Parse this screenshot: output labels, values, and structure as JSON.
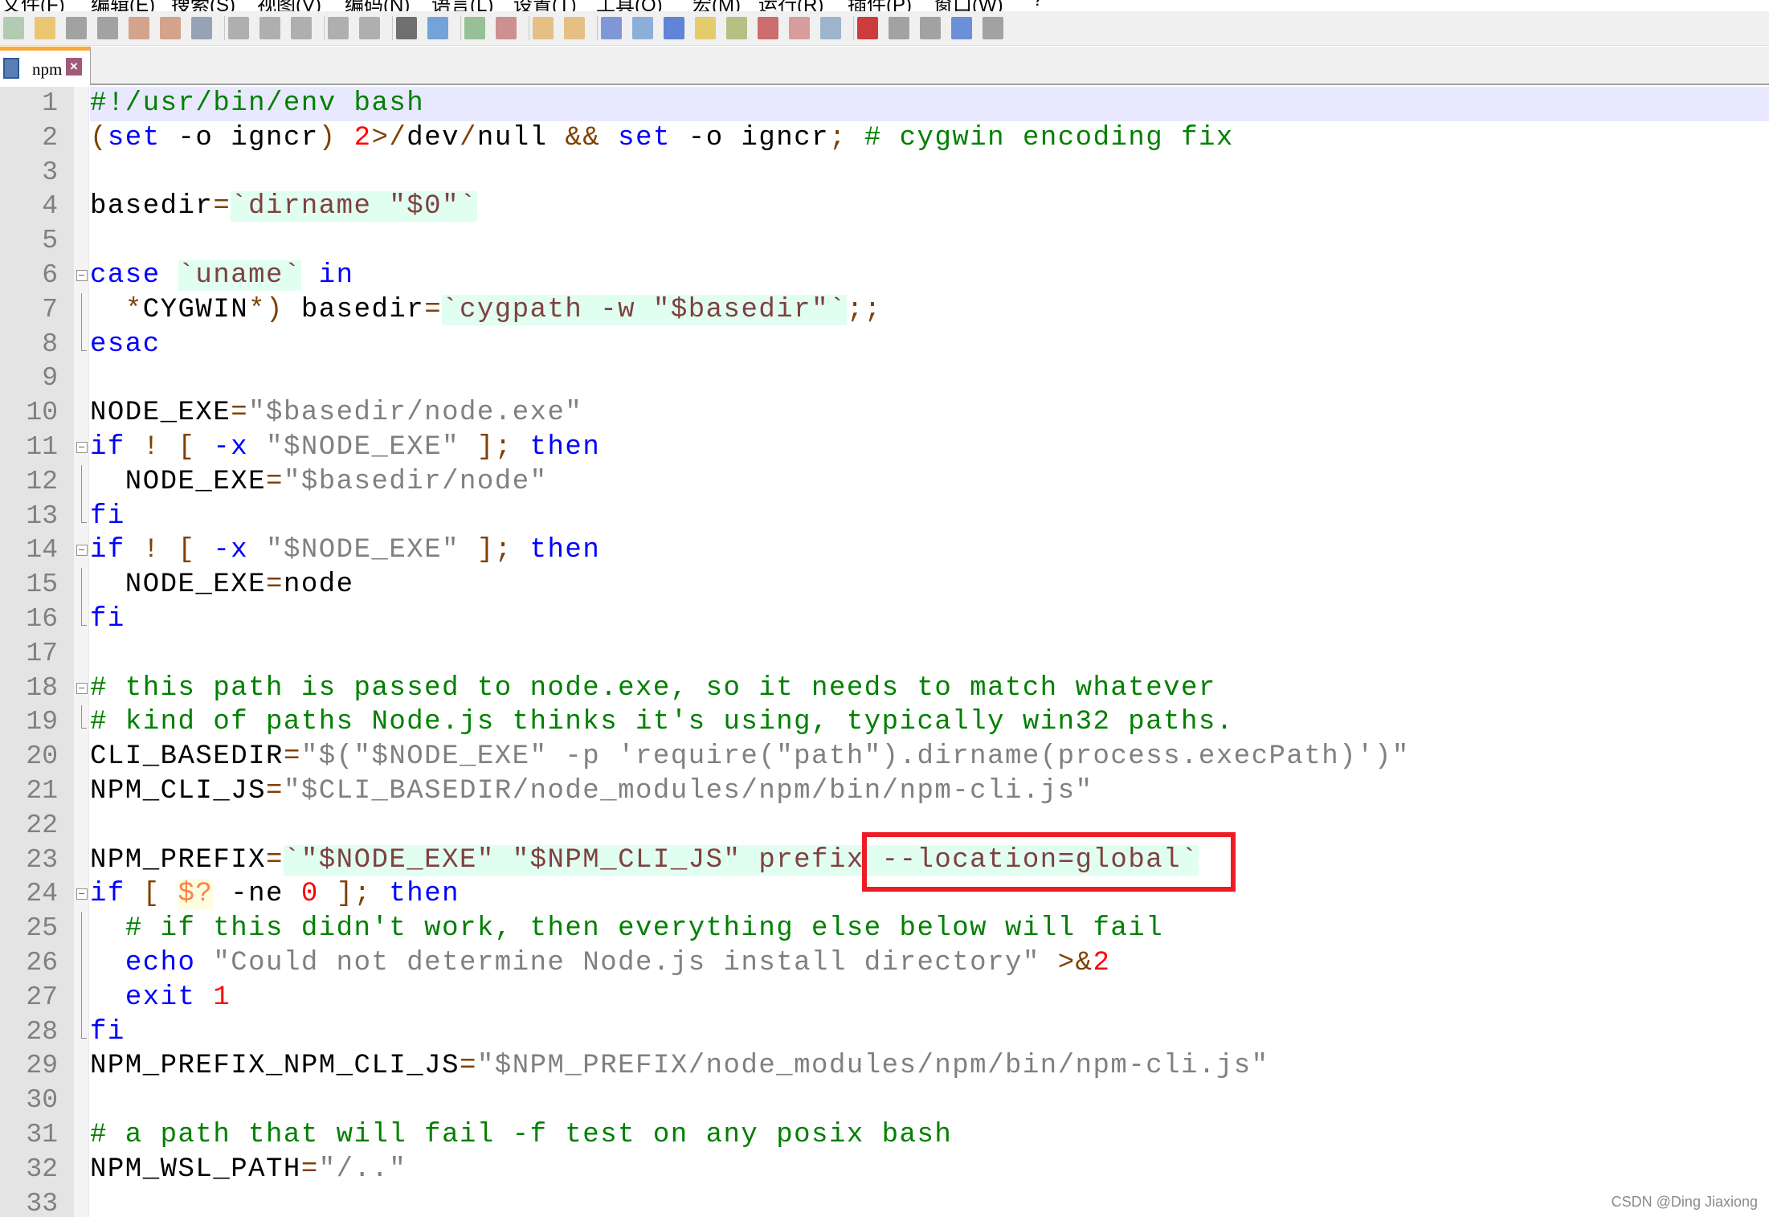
{
  "menu": [
    "文件(F)",
    "编辑(E)",
    "搜索(S)",
    "视图(V)",
    "编码(N)",
    "语言(L)",
    "设置(T)",
    "工具(O)",
    "宏(M)",
    "运行(R)",
    "插件(P)",
    "窗口(W)",
    "?"
  ],
  "toolbar": [
    "new-file-icon",
    "open-file-icon",
    "save-icon",
    "save-all-icon",
    "close-icon",
    "close-all-icon",
    "print-icon",
    "cut-icon",
    "copy-icon",
    "paste-icon",
    "undo-icon",
    "redo-icon",
    "find-icon",
    "replace-icon",
    "zoom-in-icon",
    "zoom-out-icon",
    "sync-vertical-icon",
    "sync-horizontal-icon",
    "word-wrap-icon",
    "show-all-chars-icon",
    "indent-guide-icon",
    "user-lang-icon",
    "doc-map-icon",
    "function-list-icon",
    "folder-workspace-icon",
    "monitor-icon",
    "record-macro-icon",
    "stop-record-icon",
    "play-macro-icon",
    "run-macro-multiple-icon",
    "save-macro-icon"
  ],
  "tab": {
    "label": "npm"
  },
  "colors": {
    "comment": "#008000",
    "keyword": "#0000ff",
    "string": "#808080",
    "operator": "#804000",
    "number": "#ff0000",
    "backtick_bg": "#e0fff0",
    "highlight_box": "#ee1c25"
  },
  "current_line": 1,
  "lines": [
    {
      "fold": "",
      "tokens": [
        [
          "#!/usr/bin/env bash",
          "cm"
        ]
      ]
    },
    {
      "fold": "",
      "tokens": [
        [
          "(",
          "op"
        ],
        [
          "set",
          "kw"
        ],
        [
          " -o igncr",
          "tx"
        ],
        [
          ")",
          "op"
        ],
        [
          " ",
          "tx"
        ],
        [
          "2",
          "nu"
        ],
        [
          ">/",
          "op"
        ],
        [
          "dev",
          "tx"
        ],
        [
          "/",
          "op"
        ],
        [
          "null ",
          "tx"
        ],
        [
          "&&",
          "op"
        ],
        [
          " ",
          "tx"
        ],
        [
          "set",
          "kw"
        ],
        [
          " -o igncr",
          "tx"
        ],
        [
          ";",
          "op"
        ],
        [
          " # cygwin encoding fix",
          "cm"
        ]
      ]
    },
    {
      "fold": "",
      "tokens": []
    },
    {
      "fold": "",
      "tokens": [
        [
          "basedir",
          "tx"
        ],
        [
          "=",
          "op"
        ],
        [
          "`dirname \"$0\"`",
          "bt"
        ]
      ]
    },
    {
      "fold": "",
      "tokens": []
    },
    {
      "fold": "start",
      "tokens": [
        [
          "case",
          "kw"
        ],
        [
          " ",
          "tx"
        ],
        [
          "`uname`",
          "bt"
        ],
        [
          " ",
          "tx"
        ],
        [
          "in",
          "kw"
        ]
      ]
    },
    {
      "fold": "mid",
      "tokens": [
        [
          "  ",
          "tx"
        ],
        [
          "*",
          "op"
        ],
        [
          "CYGWIN",
          "tx"
        ],
        [
          "*)",
          "op"
        ],
        [
          " basedir",
          "tx"
        ],
        [
          "=",
          "op"
        ],
        [
          "`cygpath -w \"$basedir\"`",
          "bt"
        ],
        [
          ";;",
          "op"
        ]
      ]
    },
    {
      "fold": "end",
      "tokens": [
        [
          "esac",
          "kw"
        ]
      ]
    },
    {
      "fold": "",
      "tokens": []
    },
    {
      "fold": "",
      "tokens": [
        [
          "NODE_EXE",
          "tx"
        ],
        [
          "=",
          "op"
        ],
        [
          "\"$basedir/node.exe\"",
          "st"
        ]
      ]
    },
    {
      "fold": "start",
      "tokens": [
        [
          "if",
          "kw"
        ],
        [
          " ",
          "tx"
        ],
        [
          "!",
          "op"
        ],
        [
          " ",
          "tx"
        ],
        [
          "[",
          "op"
        ],
        [
          " ",
          "tx"
        ],
        [
          "-x",
          "kw"
        ],
        [
          " ",
          "tx"
        ],
        [
          "\"$NODE_EXE\"",
          "st"
        ],
        [
          " ",
          "tx"
        ],
        [
          "]",
          "op"
        ],
        [
          ";",
          "op"
        ],
        [
          " ",
          "tx"
        ],
        [
          "then",
          "kw"
        ]
      ]
    },
    {
      "fold": "mid",
      "tokens": [
        [
          "  NODE_EXE",
          "tx"
        ],
        [
          "=",
          "op"
        ],
        [
          "\"$basedir/node\"",
          "st"
        ]
      ]
    },
    {
      "fold": "end",
      "tokens": [
        [
          "fi",
          "kw"
        ]
      ]
    },
    {
      "fold": "start",
      "tokens": [
        [
          "if",
          "kw"
        ],
        [
          " ",
          "tx"
        ],
        [
          "!",
          "op"
        ],
        [
          " ",
          "tx"
        ],
        [
          "[",
          "op"
        ],
        [
          " ",
          "tx"
        ],
        [
          "-x",
          "kw"
        ],
        [
          " ",
          "tx"
        ],
        [
          "\"$NODE_EXE\"",
          "st"
        ],
        [
          " ",
          "tx"
        ],
        [
          "]",
          "op"
        ],
        [
          ";",
          "op"
        ],
        [
          " ",
          "tx"
        ],
        [
          "then",
          "kw"
        ]
      ]
    },
    {
      "fold": "mid",
      "tokens": [
        [
          "  NODE_EXE",
          "tx"
        ],
        [
          "=",
          "op"
        ],
        [
          "node",
          "tx"
        ]
      ]
    },
    {
      "fold": "end",
      "tokens": [
        [
          "fi",
          "kw"
        ]
      ]
    },
    {
      "fold": "",
      "tokens": []
    },
    {
      "fold": "start",
      "tokens": [
        [
          "# this path is passed to node.exe, so it needs to match whatever",
          "cm"
        ]
      ]
    },
    {
      "fold": "end",
      "tokens": [
        [
          "# kind of paths Node.js thinks it's using, typically win32 paths.",
          "cm"
        ]
      ]
    },
    {
      "fold": "",
      "tokens": [
        [
          "CLI_BASEDIR",
          "tx"
        ],
        [
          "=",
          "op"
        ],
        [
          "\"$(\"$NODE_EXE\" -p 'require(\"path\").dirname(process.execPath)')\"",
          "st"
        ]
      ]
    },
    {
      "fold": "",
      "tokens": [
        [
          "NPM_CLI_JS",
          "tx"
        ],
        [
          "=",
          "op"
        ],
        [
          "\"$CLI_BASEDIR/node_modules/npm/bin/npm-cli.js\"",
          "st"
        ]
      ]
    },
    {
      "fold": "",
      "tokens": []
    },
    {
      "fold": "",
      "tokens": [
        [
          "NPM_PREFIX",
          "tx"
        ],
        [
          "=",
          "op"
        ],
        [
          "`\"$NODE_EXE\" \"$NPM_CLI_JS\" prefix --location=global`",
          "bt"
        ]
      ]
    },
    {
      "fold": "start",
      "tokens": [
        [
          "if",
          "kw"
        ],
        [
          " ",
          "tx"
        ],
        [
          "[",
          "op"
        ],
        [
          " ",
          "tx"
        ],
        [
          "$?",
          "var"
        ],
        [
          " -ne ",
          "tx"
        ],
        [
          "0",
          "nu"
        ],
        [
          " ",
          "tx"
        ],
        [
          "]",
          "op"
        ],
        [
          ";",
          "op"
        ],
        [
          " ",
          "tx"
        ],
        [
          "then",
          "kw"
        ]
      ]
    },
    {
      "fold": "mid",
      "tokens": [
        [
          "  ",
          "tx"
        ],
        [
          "# if this didn't work, then everything else below will fail",
          "cm"
        ]
      ]
    },
    {
      "fold": "mid",
      "tokens": [
        [
          "  ",
          "tx"
        ],
        [
          "echo",
          "kw"
        ],
        [
          " ",
          "tx"
        ],
        [
          "\"Could not determine Node.js install directory\"",
          "st"
        ],
        [
          " ",
          "tx"
        ],
        [
          ">&",
          "op"
        ],
        [
          "2",
          "nu"
        ]
      ]
    },
    {
      "fold": "mid",
      "tokens": [
        [
          "  ",
          "tx"
        ],
        [
          "exit",
          "kw"
        ],
        [
          " ",
          "tx"
        ],
        [
          "1",
          "nu"
        ]
      ]
    },
    {
      "fold": "end",
      "tokens": [
        [
          "fi",
          "kw"
        ]
      ]
    },
    {
      "fold": "",
      "tokens": [
        [
          "NPM_PREFIX_NPM_CLI_JS",
          "tx"
        ],
        [
          "=",
          "op"
        ],
        [
          "\"$NPM_PREFIX/node_modules/npm/bin/npm-cli.js\"",
          "st"
        ]
      ]
    },
    {
      "fold": "",
      "tokens": []
    },
    {
      "fold": "",
      "tokens": [
        [
          "# a path that will fail -f test on any posix bash",
          "cm"
        ]
      ]
    },
    {
      "fold": "",
      "tokens": [
        [
          "NPM_WSL_PATH",
          "tx"
        ],
        [
          "=",
          "op"
        ],
        [
          "\"/..\"",
          "st"
        ]
      ]
    },
    {
      "fold": "",
      "tokens": []
    }
  ],
  "watermark": "CSDN @Ding Jiaxiong"
}
